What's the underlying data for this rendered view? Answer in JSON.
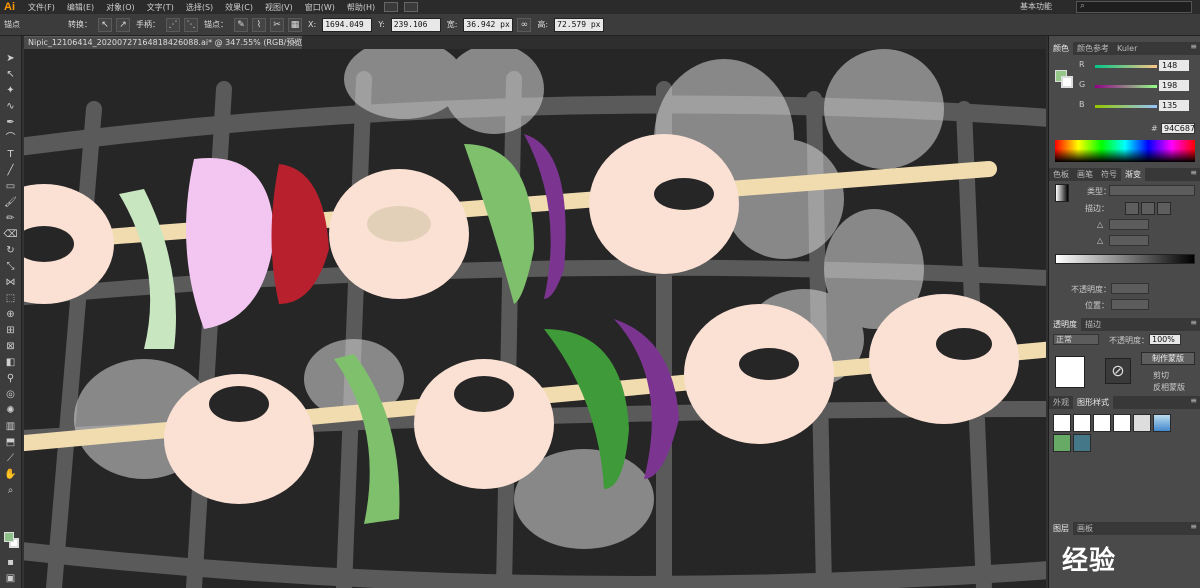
{
  "app": {
    "logo": "Ai",
    "menu": [
      "文件(F)",
      "编辑(E)",
      "对象(O)",
      "文字(T)",
      "选择(S)",
      "效果(C)",
      "视图(V)",
      "窗口(W)",
      "帮助(H)"
    ],
    "workspace": "基本功能",
    "search_placeholder": ""
  },
  "control_bar": {
    "anchor_label": "锚点",
    "convert_label": "转换：",
    "handle_label": "手柄：",
    "anchor2_label": "锚点：",
    "x_label": "X:",
    "x_value": "1694.049",
    "y_label": "Y:",
    "y_value": "239.106",
    "w_label": "宽:",
    "w_value": "36.942 px",
    "h_label": "高:",
    "h_value": "72.579 px"
  },
  "document": {
    "tab_title": "Nipic_12106414_20200727164818426088.ai* @ 347.55% (RGB/预览)",
    "close": "×"
  },
  "color_panel": {
    "tabs": [
      "颜色",
      "颜色参考",
      "Kuler"
    ],
    "r_label": "R",
    "r_value": "148",
    "g_label": "G",
    "g_value": "198",
    "b_label": "B",
    "b_value": "135",
    "hex_label": "#",
    "hex_value": "94C687",
    "fill_color": "#94C687"
  },
  "gradient_panel": {
    "tabs": [
      "色板",
      "画笔",
      "符号",
      "渐变"
    ],
    "type_label": "类型：",
    "stroke_label": "描边：",
    "angle_label": "△",
    "ratio_label": "△",
    "opacity_label": "不透明度：",
    "position_label": "位置："
  },
  "transparency_panel": {
    "tabs": [
      "透明度",
      "描边"
    ],
    "mode": "正常",
    "opacity_label": "不透明度：",
    "opacity_value": "100%",
    "make_mask": "制作蒙版",
    "clip_label": "剪切",
    "invert_label": "反相蒙版"
  },
  "graphic_styles": {
    "tabs": [
      "外观",
      "图形样式"
    ]
  },
  "layers": {
    "tabs": [
      "图层",
      "画板"
    ]
  },
  "watermark": "经验"
}
